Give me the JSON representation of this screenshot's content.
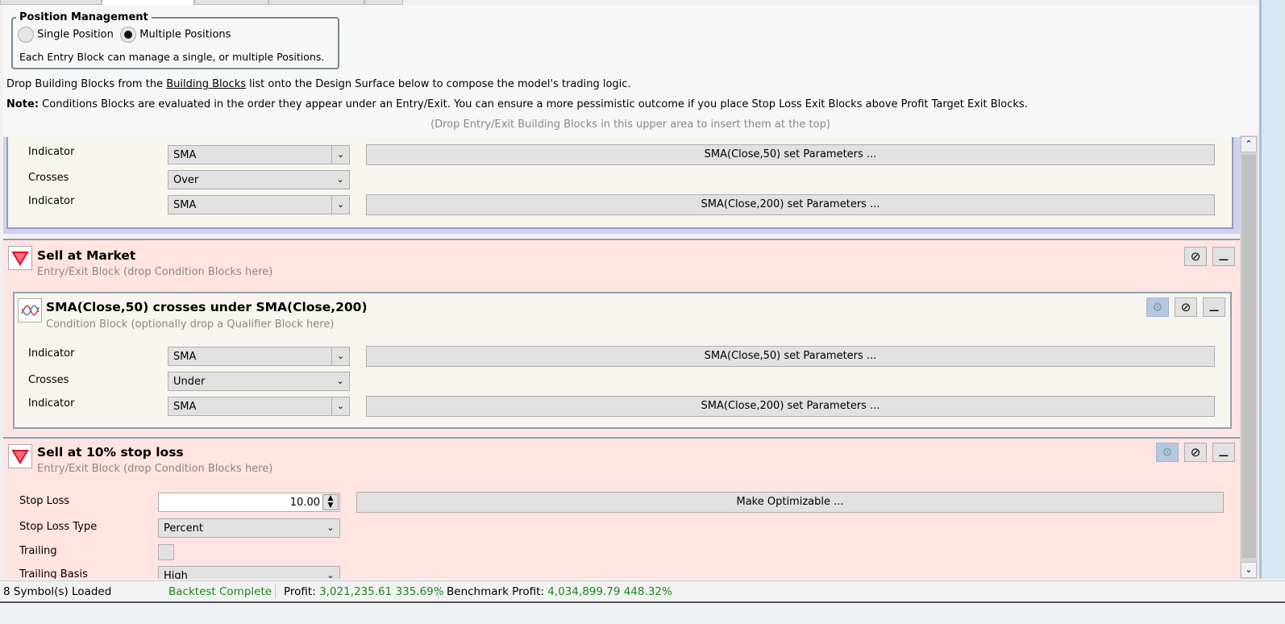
{
  "position_management": {
    "title": "Position Management",
    "single": "Single Position",
    "multiple": "Multiple Positions",
    "selected": "multiple",
    "description": "Each Entry Block can manage a single, or multiple Positions."
  },
  "instructions": {
    "prefix": "Drop Building Blocks from the ",
    "link": "Building Blocks",
    "suffix": " list onto the Design Surface below to compose the model's trading logic.",
    "note_label": "Note:",
    "note": " Conditions Blocks are evaluated in the order they appear under an Entry/Exit. You can ensure a more pessimistic outcome if you place Stop Loss Exit Blocks above Profit Target Exit Blocks.",
    "drop_hint": "(Drop Entry/Exit Building Blocks in this upper area to insert them at the top)"
  },
  "buy_condition": {
    "rows": [
      {
        "label": "Indicator",
        "value": "SMA",
        "button": "SMA(Close,50) set Parameters ..."
      },
      {
        "label": "Crosses",
        "value": "Over"
      },
      {
        "label": "Indicator",
        "value": "SMA",
        "button": "SMA(Close,200) set Parameters ..."
      }
    ]
  },
  "sell_market": {
    "title": "Sell at Market",
    "subtitle": "Entry/Exit Block (drop Condition Blocks here)",
    "condition": {
      "title": "SMA(Close,50) crosses under SMA(Close,200)",
      "subtitle": "Condition Block (optionally drop a Qualifier Block here)",
      "rows": [
        {
          "label": "Indicator",
          "value": "SMA",
          "button": "SMA(Close,50) set Parameters ..."
        },
        {
          "label": "Crosses",
          "value": "Under"
        },
        {
          "label": "Indicator",
          "value": "SMA",
          "button": "SMA(Close,200) set Parameters ..."
        }
      ]
    }
  },
  "stop_loss": {
    "title": "Sell at 10% stop loss",
    "subtitle": "Entry/Exit Block (drop Condition Blocks here)",
    "stop_loss_label": "Stop Loss",
    "stop_loss_value": "10.00",
    "optimize_button": "Make Optimizable ...",
    "type_label": "Stop Loss Type",
    "type_value": "Percent",
    "trailing_label": "Trailing",
    "trailing_checked": false,
    "basis_label": "Trailing Basis",
    "basis_value": "High"
  },
  "status": {
    "symbols": "8 Symbol(s) Loaded",
    "backtest": "Backtest Complete",
    "profit_label": "Profit:",
    "profit": "3,021,235.61 335.69%",
    "bench_label": "Benchmark Profit:",
    "bench": "4,034,899.79 448.32%"
  },
  "colors": {
    "entry_exit_bg": "#ffe4e1",
    "condition_bg": "#f8f5ef",
    "buy_border": "#d0d0f4",
    "profit_green": "#1a8a1a"
  }
}
